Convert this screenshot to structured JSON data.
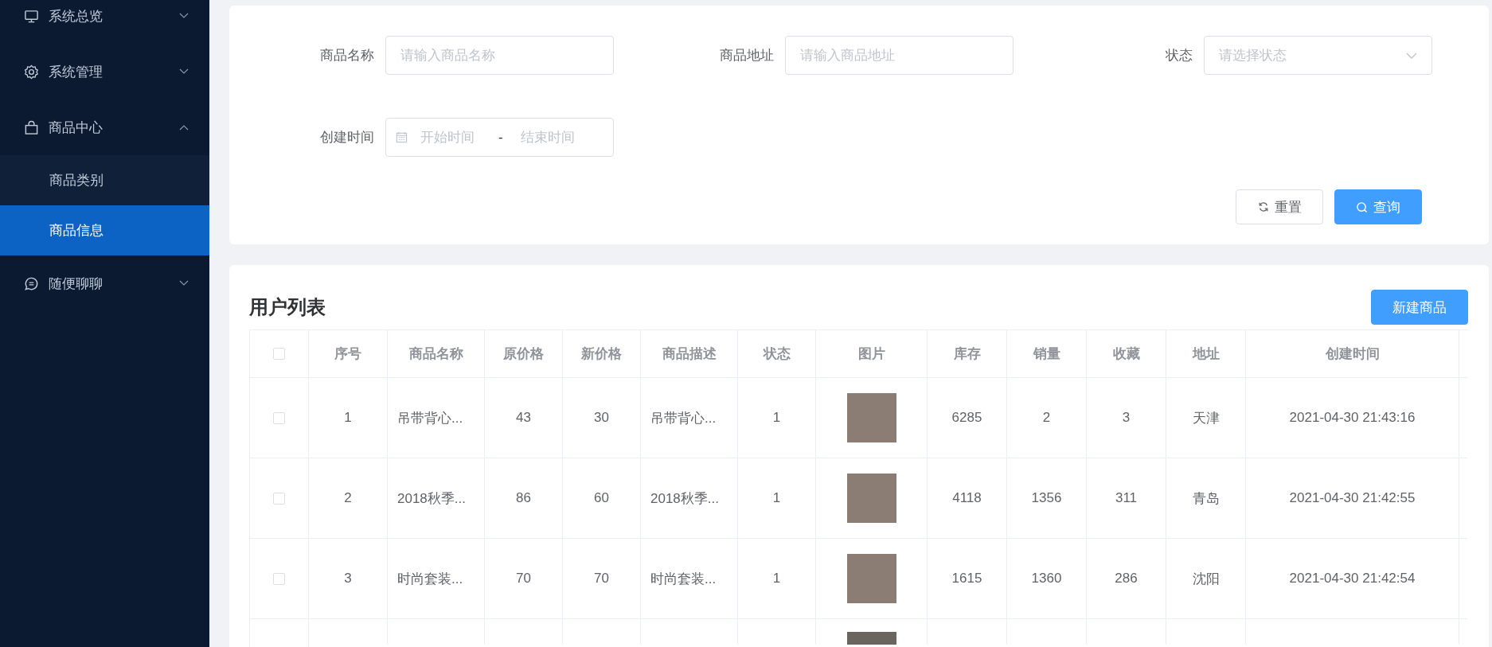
{
  "sidebar": {
    "items": [
      {
        "label": "系统总览",
        "expanded": false
      },
      {
        "label": "系统管理",
        "expanded": false
      },
      {
        "label": "商品中心",
        "expanded": true,
        "children": [
          {
            "label": "商品类别",
            "selected": false
          },
          {
            "label": "商品信息",
            "selected": true
          }
        ]
      },
      {
        "label": "随便聊聊",
        "expanded": false
      }
    ]
  },
  "filter": {
    "fields": [
      {
        "kind": "text",
        "label": "商品名称",
        "placeholder": "请输入商品名称"
      },
      {
        "kind": "text",
        "label": "商品地址",
        "placeholder": "请输入商品地址"
      },
      {
        "kind": "select",
        "label": "状态",
        "placeholder": "请选择状态"
      },
      {
        "kind": "daterange",
        "label": "创建时间",
        "start_placeholder": "开始时间",
        "separator": "-",
        "end_placeholder": "结束时间"
      }
    ],
    "buttons": [
      {
        "kind": "reset",
        "label": "重置"
      },
      {
        "kind": "search",
        "label": "查询"
      }
    ]
  },
  "list": {
    "title": "用户列表",
    "create_button": "新建商品",
    "table": {
      "select_all_checked": false,
      "columns": [
        {
          "kind": "text",
          "label": "序号"
        },
        {
          "kind": "text",
          "label": "商品名称"
        },
        {
          "kind": "text",
          "label": "原价格"
        },
        {
          "kind": "text",
          "label": "新价格"
        },
        {
          "kind": "text",
          "label": "商品描述"
        },
        {
          "kind": "text",
          "label": "状态"
        },
        {
          "kind": "image",
          "label": "图片"
        },
        {
          "kind": "text",
          "label": "库存"
        },
        {
          "kind": "text",
          "label": "销量"
        },
        {
          "kind": "text",
          "label": "收藏"
        },
        {
          "kind": "text",
          "label": "地址"
        },
        {
          "kind": "text",
          "label": "创建时间"
        }
      ],
      "rows": [
        {
          "checked": false,
          "cells": [
            "1",
            "吊带背心...",
            "43",
            "30",
            "吊带背心...",
            "1",
            "",
            "6285",
            "2",
            "3",
            "天津",
            "2021-04-30 21:43:16"
          ]
        },
        {
          "checked": false,
          "cells": [
            "2",
            "2018秋季...",
            "86",
            "60",
            "2018秋季...",
            "1",
            "",
            "4118",
            "1356",
            "311",
            "青岛",
            "2021-04-30 21:42:55"
          ]
        },
        {
          "checked": false,
          "cells": [
            "3",
            "时尚套装...",
            "70",
            "70",
            "时尚套装...",
            "1",
            "",
            "1615",
            "1360",
            "286",
            "沈阳",
            "2021-04-30 21:42:54"
          ]
        }
      ]
    }
  }
}
